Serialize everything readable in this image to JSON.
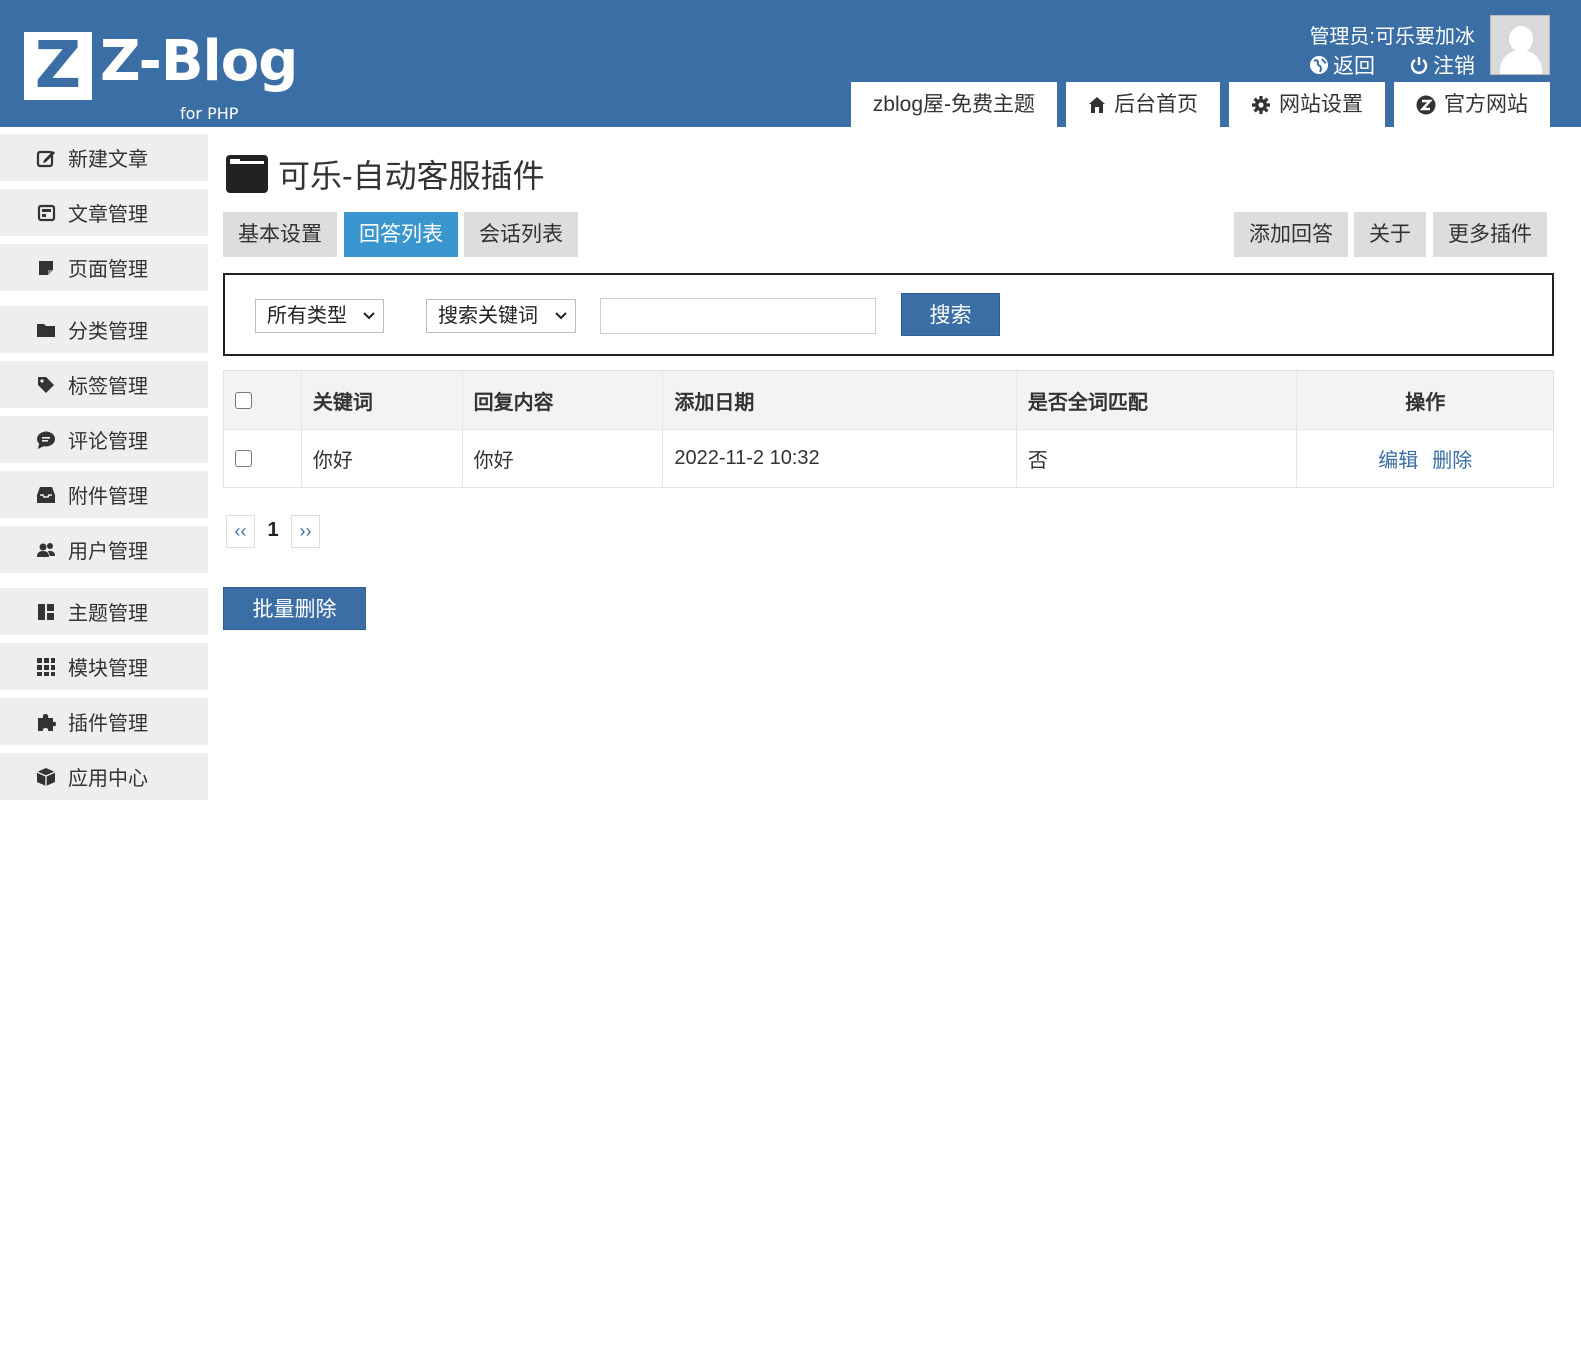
{
  "header": {
    "logo_mark": "Z",
    "logo_text": "Z-Blog",
    "logo_sub": "for PHP",
    "admin_label": "管理员:可乐要加冰",
    "back_label": "返回",
    "logout_label": "注销",
    "tabs": [
      {
        "label": "zblog屋-免费主题",
        "icon": ""
      },
      {
        "label": "后台首页",
        "icon": "home-icon"
      },
      {
        "label": "网站设置",
        "icon": "gear-icon"
      },
      {
        "label": "官方网站",
        "icon": "zblog-icon"
      }
    ]
  },
  "sidebar": {
    "items": [
      {
        "label": "新建文章",
        "icon": "edit-icon"
      },
      {
        "label": "文章管理",
        "icon": "article-icon"
      },
      {
        "label": "页面管理",
        "icon": "page-icon"
      },
      {
        "label": "分类管理",
        "icon": "folder-icon"
      },
      {
        "label": "标签管理",
        "icon": "tag-icon"
      },
      {
        "label": "评论管理",
        "icon": "comment-icon"
      },
      {
        "label": "附件管理",
        "icon": "inbox-icon"
      },
      {
        "label": "用户管理",
        "icon": "users-icon"
      },
      {
        "label": "主题管理",
        "icon": "layout-icon"
      },
      {
        "label": "模块管理",
        "icon": "grid-icon"
      },
      {
        "label": "插件管理",
        "icon": "puzzle-icon"
      },
      {
        "label": "应用中心",
        "icon": "box-icon"
      }
    ]
  },
  "main": {
    "title": "可乐-自动客服插件",
    "tabs_left": [
      "基本设置",
      "回答列表",
      "会话列表"
    ],
    "active_tab": "回答列表",
    "tabs_right": [
      "添加回答",
      "关于",
      "更多插件"
    ],
    "search": {
      "type_select": "所有类型",
      "field_select": "搜索关键词",
      "keyword_value": "",
      "button": "搜索"
    },
    "table": {
      "headers": [
        "关键词",
        "回复内容",
        "添加日期",
        "是否全词匹配",
        "操作"
      ],
      "rows": [
        {
          "keyword": "你好",
          "reply": "你好",
          "date": "2022-11-2 10:32",
          "full_match": "否",
          "edit": "编辑",
          "delete": "删除"
        }
      ]
    },
    "pager": {
      "prev": "‹‹",
      "current": "1",
      "next": "››"
    },
    "batch_delete": "批量删除"
  },
  "colors": {
    "brand": "#3a6ea5",
    "active_tab": "#3a96cf",
    "sidebar_bg": "#eeeeee"
  }
}
